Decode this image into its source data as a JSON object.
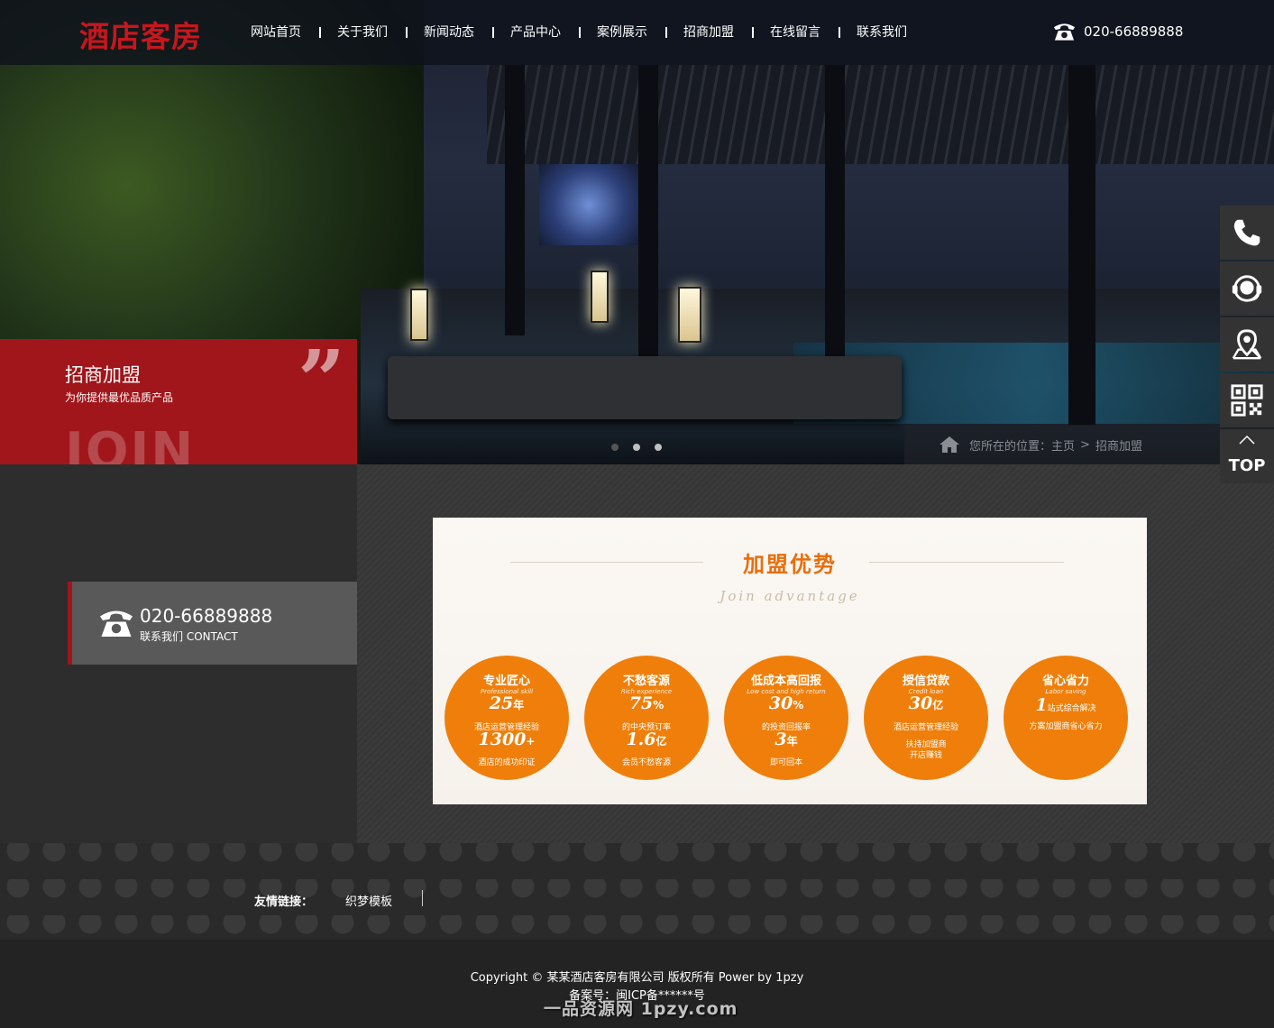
{
  "header": {
    "logo_text": "酒店客房",
    "nav": [
      "网站首页",
      "关于我们",
      "新闻动态",
      "产品中心",
      "案例展示",
      "招商加盟",
      "在线留言",
      "联系我们"
    ],
    "phone": "020-66889888",
    "phone_icon": "telephone-icon"
  },
  "banner": {
    "title": "招商加盟",
    "subtitle": "为你提供最优品质产品",
    "quote_glyph": "”",
    "bg_word": "JOIN",
    "dots": 3,
    "active_dot": 0
  },
  "breadcrumb": {
    "prefix": "您所在的位置：",
    "home": "主页",
    "separator": ">",
    "current": "招商加盟"
  },
  "contact": {
    "phone": "020-66889888",
    "label": "联系我们 CONTACT"
  },
  "advantage": {
    "title": "加盟优势",
    "subtitle": "Join advantage",
    "circles": [
      {
        "title": "专业匠心",
        "en": "Professional skill",
        "big1": "25",
        "unit1": "年",
        "line1": "酒店运营管理经验",
        "big2": "1300",
        "unit2": "+",
        "line2": "酒店的成功印证"
      },
      {
        "title": "不愁客源",
        "en": "Rich experience",
        "big1": "75",
        "unit1": "%",
        "line1": "的中央预订率",
        "big2": "1.6",
        "unit2": "亿",
        "line2": "会员不愁客源"
      },
      {
        "title": "低成本高回报",
        "en": "Low cost and high return",
        "big1": "30",
        "unit1": "%",
        "line1": "的投资回报率",
        "big2": "3",
        "unit2": "年",
        "line2": "即可回本"
      },
      {
        "title": "授信贷款",
        "en": "Credit loan",
        "big1": "30",
        "unit1": "亿",
        "line1": "酒店运营管理经验",
        "big2": "",
        "unit2": "",
        "line2": "扶持加盟商",
        "line3": "开店赚钱"
      },
      {
        "title": "省心省力",
        "en": "Labor saving",
        "big1": "1",
        "unit1": "站式综合解决",
        "line1": "方案加盟商省心省力",
        "big2": "",
        "unit2": "",
        "line2": ""
      }
    ],
    "accent": "#ef7f0a"
  },
  "float_bar": {
    "items": [
      "phone-icon",
      "customer-service-icon",
      "map-pin-icon",
      "qr-code-icon",
      "back-to-top-icon"
    ],
    "top_label": "TOP"
  },
  "footer": {
    "links_label": "友情链接：",
    "links": [
      "织梦模板"
    ],
    "copyright": "Copyright © 某某酒店客房有限公司 版权所有 Power by 1pzy",
    "beian": "备案号：闽ICP备******号",
    "watermark": "一品资源网 1pzy.com"
  },
  "colors": {
    "brand_red": "#a0161b",
    "logo_red": "#c8161d",
    "orange": "#ef7f0a"
  }
}
